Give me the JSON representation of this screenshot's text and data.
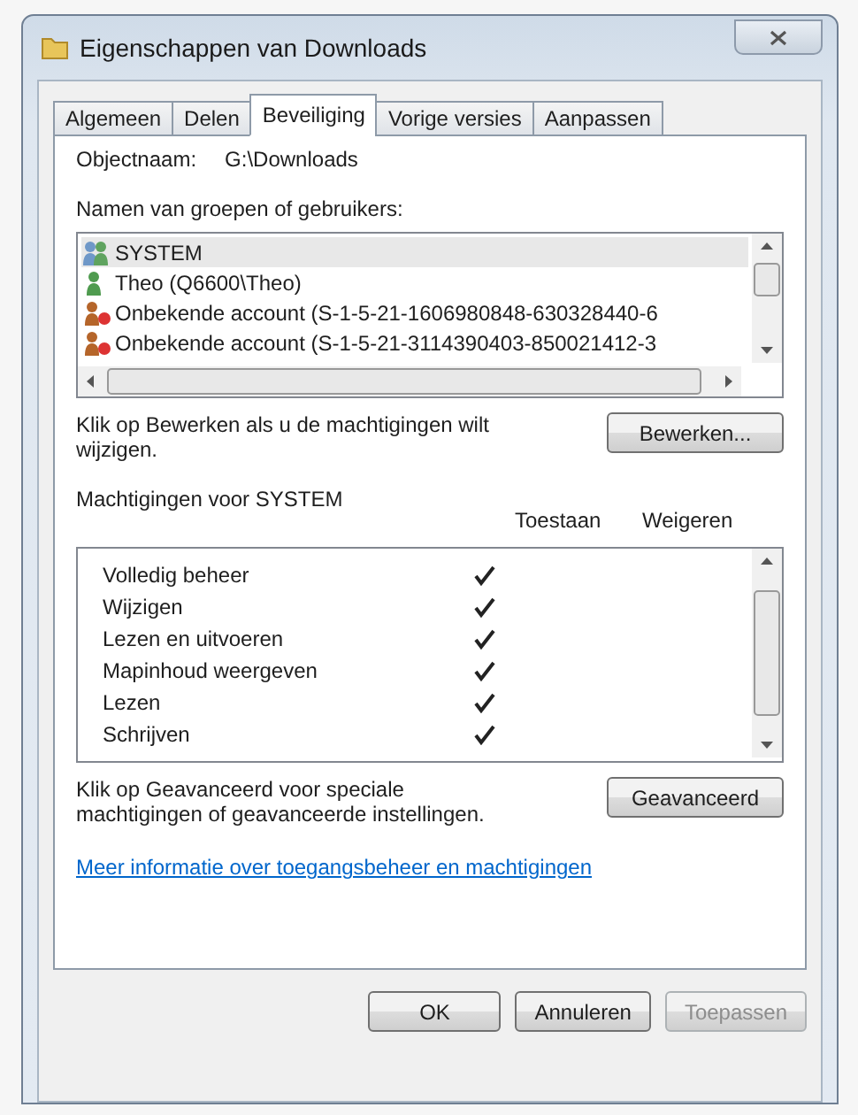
{
  "window": {
    "title": "Eigenschappen van Downloads"
  },
  "tabs": [
    {
      "label": "Algemeen",
      "selected": false
    },
    {
      "label": "Delen",
      "selected": false
    },
    {
      "label": "Beveiliging",
      "selected": true
    },
    {
      "label": "Vorige versies",
      "selected": false
    },
    {
      "label": "Aanpassen",
      "selected": false
    }
  ],
  "object": {
    "label": "Objectnaam:",
    "value": "G:\\Downloads"
  },
  "users": {
    "heading": "Namen van groepen of gebruikers:",
    "items": [
      {
        "name": "SYSTEM",
        "kind": "group",
        "selected": true
      },
      {
        "name": "Theo (Q6600\\Theo)",
        "kind": "user",
        "selected": false
      },
      {
        "name": "Onbekende account (S-1-5-21-1606980848-630328440-6",
        "kind": "unknown",
        "selected": false
      },
      {
        "name": "Onbekende account (S-1-5-21-3114390403-850021412-3",
        "kind": "unknown",
        "selected": false
      }
    ]
  },
  "edit": {
    "text": "Klik op Bewerken als u de machtigingen wilt wijzigen.",
    "button": "Bewerken..."
  },
  "permissions": {
    "heading": "Machtigingen voor SYSTEM",
    "allow_label": "Toestaan",
    "deny_label": "Weigeren",
    "rows": [
      {
        "name": "Volledig beheer",
        "allow": true
      },
      {
        "name": "Wijzigen",
        "allow": true
      },
      {
        "name": "Lezen en uitvoeren",
        "allow": true
      },
      {
        "name": "Mapinhoud weergeven",
        "allow": true
      },
      {
        "name": "Lezen",
        "allow": true
      },
      {
        "name": "Schrijven",
        "allow": true
      }
    ]
  },
  "advanced": {
    "text": "Klik op Geavanceerd voor speciale machtigingen of geavanceerde instellingen.",
    "button": "Geavanceerd"
  },
  "link": "Meer informatie over toegangsbeheer en machtigingen",
  "buttons": [
    {
      "label": "OK",
      "disabled": false
    },
    {
      "label": "Annuleren",
      "disabled": false
    },
    {
      "label": "Toepassen",
      "disabled": true
    }
  ]
}
